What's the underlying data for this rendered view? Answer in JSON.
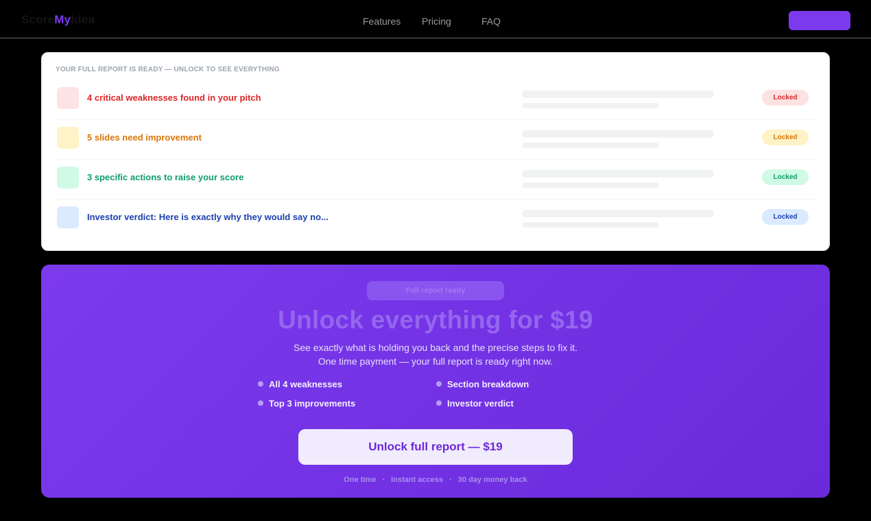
{
  "nav": {
    "logo_part1": "Score",
    "logo_part2": "My",
    "logo_part3": "Idea",
    "links": [
      "Features",
      "Pricing",
      "FAQ"
    ],
    "cta_label": ""
  },
  "report": {
    "heading": "YOUR FULL REPORT IS READY — UNLOCK TO SEE EVERYTHING",
    "rows": [
      {
        "title": "4 critical weaknesses found in your pitch",
        "status": "Locked",
        "color": "#dc2626",
        "square": "#fde4e4",
        "pill_bg": "#fde2e2",
        "pill_fg": "#dc2626"
      },
      {
        "title": "5 slides need improvement",
        "status": "Locked",
        "color": "#d97706",
        "square": "#fef3c7",
        "pill_bg": "#fef3c7",
        "pill_fg": "#d97706"
      },
      {
        "title": "3 specific actions to raise your score",
        "status": "Locked",
        "color": "#0f9d6a",
        "square": "#d1fae5",
        "pill_bg": "#d1fae5",
        "pill_fg": "#0f9d6a"
      },
      {
        "title": "Investor verdict: Here is exactly why they would say no...",
        "status": "Locked",
        "color": "#1e40af",
        "square": "#dbeafe",
        "pill_bg": "#dbeafe",
        "pill_fg": "#1e40af"
      }
    ]
  },
  "unlock": {
    "badge": "Full report ready",
    "headline": "Unlock everything for $19",
    "sub_line1": "See exactly what is holding you back and the precise steps to fix it.",
    "sub_line2": "One time payment — your full report is ready right now.",
    "features": [
      "All 4 weaknesses",
      "Section breakdown",
      "Top 3 improvements",
      "Investor verdict"
    ],
    "cta_label": "Unlock full report — $19",
    "footer": [
      "One time",
      "·",
      "Instant access",
      "·",
      "30 day money back"
    ]
  },
  "colors": {
    "accent": "#7c3aed"
  }
}
